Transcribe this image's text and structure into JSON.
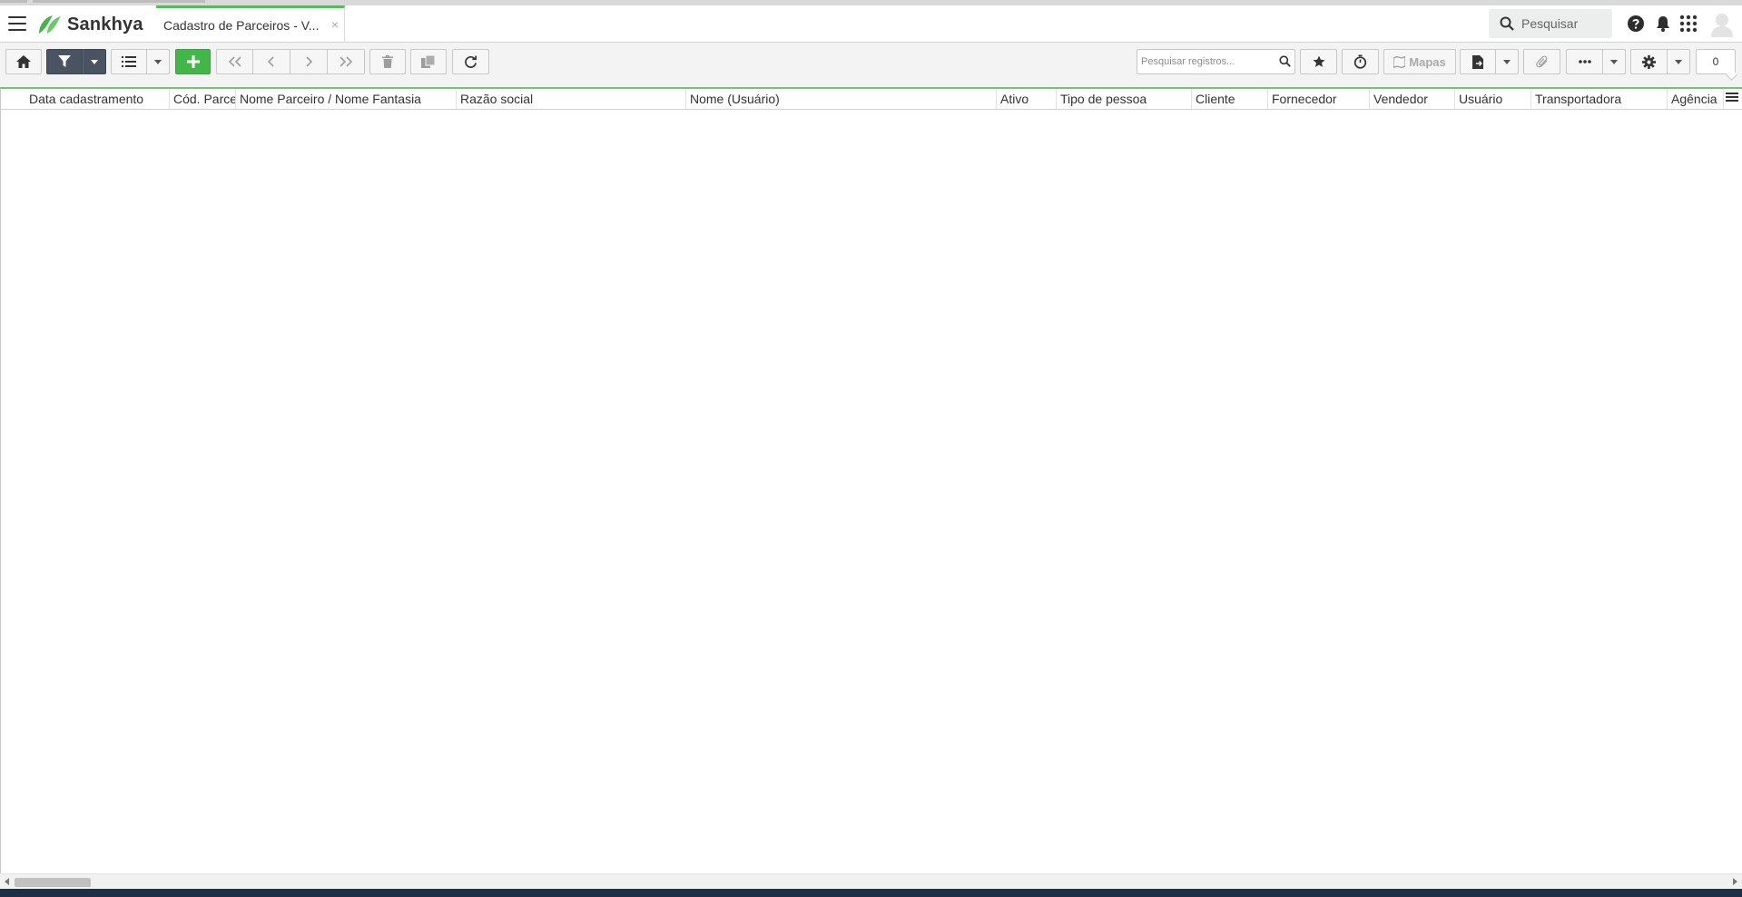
{
  "app": {
    "brand": "Sankhya",
    "brand_color": "#43b649"
  },
  "tabs": [
    {
      "label": "Cadastro de Parceiros - V...",
      "close_icon": "×"
    }
  ],
  "header": {
    "search_placeholder": "Pesquisar",
    "icons": [
      "menu-icon",
      "search-icon",
      "help-icon",
      "bell-icon",
      "apps-grid-icon",
      "user-avatar"
    ]
  },
  "toolbar": {
    "record_search_placeholder": "Pesquisar registros...",
    "maps_label": "Mapas",
    "record_count": "0",
    "icons": [
      "home-icon",
      "filter-icon",
      "list-icon",
      "add-icon",
      "first-icon",
      "previous-icon",
      "next-icon",
      "last-icon",
      "delete-icon",
      "duplicate-icon",
      "refresh-icon",
      "star-icon",
      "timer-icon",
      "map-icon",
      "document-icon",
      "attachment-icon",
      "more-icon",
      "gear-icon"
    ]
  },
  "grid": {
    "columns": [
      "Data cadastramento",
      "Cód. Parceiro",
      "Nome Parceiro / Nome Fantasia",
      "Razão social",
      "Nome (Usuário)",
      "Ativo",
      "Tipo de pessoa",
      "Cliente",
      "Fornecedor",
      "Vendedor",
      "Usuário",
      "Transportadora",
      "Agência"
    ],
    "rows": []
  }
}
